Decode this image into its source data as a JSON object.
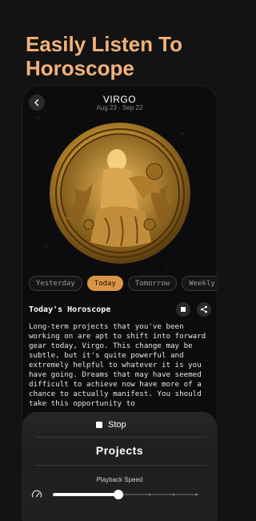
{
  "promo": {
    "title": "Easily Listen To Horoscope"
  },
  "header": {
    "sign": "VIRGO",
    "dates": "Aug 23 - Sep 22"
  },
  "tabs": [
    {
      "label": "Yesterday",
      "active": false
    },
    {
      "label": "Today",
      "active": true
    },
    {
      "label": "Tomorrow",
      "active": false
    },
    {
      "label": "Weekly",
      "active": false
    }
  ],
  "horoscope": {
    "title": "Today's Horoscope",
    "text": "Long-term projects that you've been working on are apt to shift into forward gear today, Virgo. This change may be subtle, but it's quite powerful and extremely helpful to whatever it is you have going. Dreams that may have seemed difficult to achieve now have more of a chance to actually manifest. You should take this opportunity to"
  },
  "player": {
    "stop_label": "Stop",
    "track": "Projects",
    "speed_label": "Playback Speed",
    "speed_level": 0.45
  },
  "colors": {
    "accent": "#d99547",
    "promo_title": "#f2b27a",
    "background": "#131313"
  },
  "icons": {
    "back": "chevron-left-icon",
    "stop": "stop-icon",
    "share": "share-icon",
    "speed": "speedometer-icon"
  }
}
